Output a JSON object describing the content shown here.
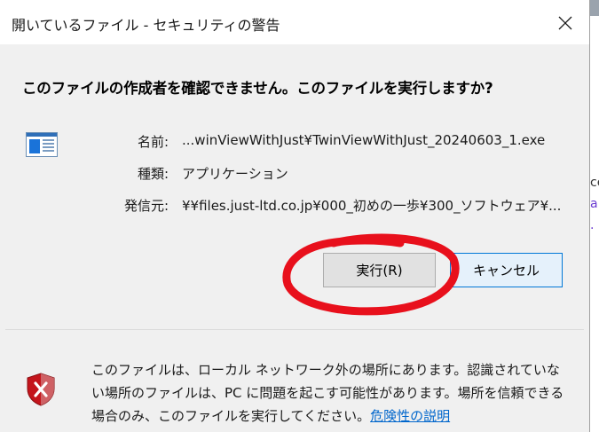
{
  "dialog": {
    "title": "開いているファイル - セキュリティの警告",
    "headline": "このファイルの作成者を確認できません。このファイルを実行しますか?",
    "fields": [
      {
        "label": "名前:",
        "value": "...winViewWithJust¥TwinViewWithJust_20240603_1.exe"
      },
      {
        "label": "種類:",
        "value": "アプリケーション"
      },
      {
        "label": "発信元:",
        "value": "¥¥files.just-ltd.co.jp¥000_初めの一歩¥300_ソフトウェア¥..."
      }
    ],
    "buttons": {
      "run": "実行(R)",
      "cancel": "キャンセル"
    },
    "warning_text": "このファイルは、ローカル ネットワーク外の場所にあります。認識されていない場所のファイルは、PC に問題を起こす可能性があります。場所を信頼できる場合のみ、このファイルを実行してください。",
    "warning_link": "危険性の説明",
    "highlight_color": "#e8101c",
    "icons": {
      "close": "close-icon",
      "file": "application-file-icon",
      "warning": "security-shield-icon"
    }
  },
  "background_window": {
    "glyphs": [
      "ce",
      "a",
      "."
    ]
  }
}
